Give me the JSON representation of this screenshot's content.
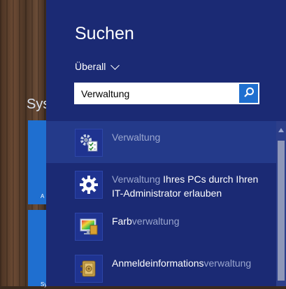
{
  "background": {
    "start_label": "Sys",
    "tile_labels": [
      "A",
      "Sy"
    ]
  },
  "pane": {
    "title": "Suchen",
    "scope_label": "Überall"
  },
  "search": {
    "value": "Verwaltung"
  },
  "results": [
    {
      "prefix": "",
      "match": "Verwaltung",
      "suffix": "",
      "selected": true,
      "icon": "admin-tools-icon"
    },
    {
      "prefix": "",
      "match": "Verwaltung",
      "suffix": " Ihres PCs durch Ihren IT-Administrator erlauben",
      "selected": false,
      "icon": "gear-icon"
    },
    {
      "prefix": "Farb",
      "match": "verwaltung",
      "suffix": "",
      "selected": false,
      "icon": "color-management-icon"
    },
    {
      "prefix": "Anmeldeinformations",
      "match": "verwaltung",
      "suffix": "",
      "selected": false,
      "icon": "credential-vault-icon"
    }
  ],
  "colors": {
    "pane_bg": "#1b2a74",
    "selected_bg": "#243a8a",
    "accent": "#1f6fd0",
    "match_text": "#9aa6cf"
  }
}
